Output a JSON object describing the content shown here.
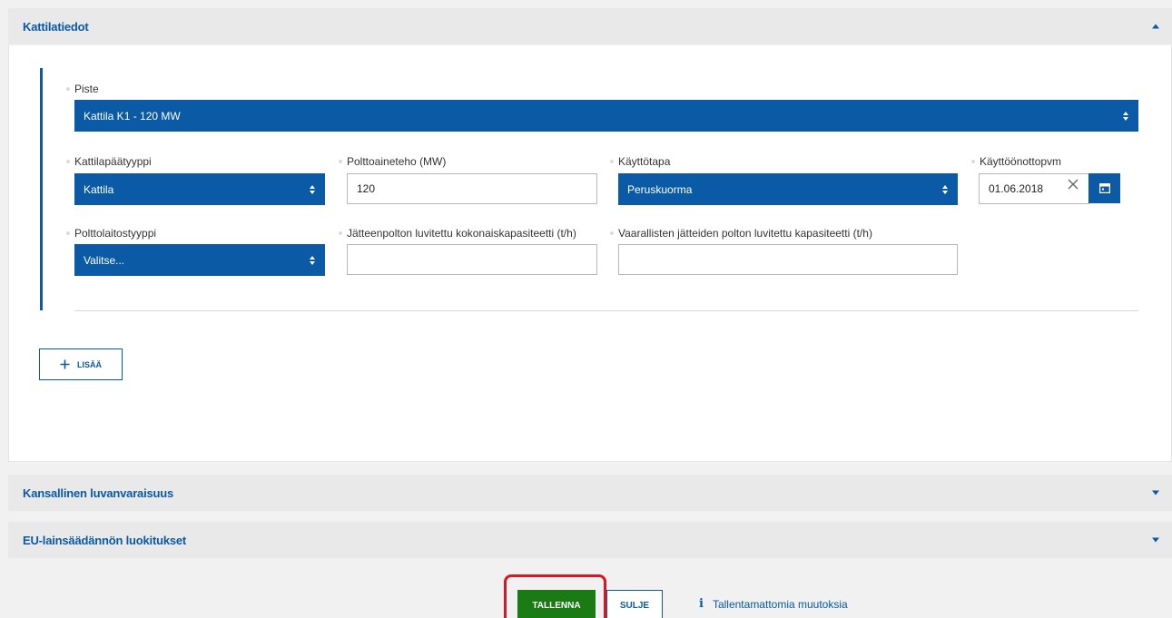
{
  "sections": {
    "kattilatiedot": {
      "title": "Kattilatiedot"
    },
    "kansallinen": {
      "title": "Kansallinen luvanvaraisuus"
    },
    "eu": {
      "title": "EU-lainsäädännön luokitukset"
    }
  },
  "form": {
    "piste": {
      "label": "Piste",
      "value": "Kattila K1 - 120 MW"
    },
    "kattilapaatyyppi": {
      "label": "Kattilapäätyyppi",
      "value": "Kattila"
    },
    "polttoaineteho": {
      "label": "Polttoaineteho (MW)",
      "value": "120"
    },
    "kayttotapa": {
      "label": "Käyttötapa",
      "value": "Peruskuorma"
    },
    "kayttoonottopvm": {
      "label": "Käyttöönottopvm",
      "value": "01.06.2018"
    },
    "polttolaitostyyppi": {
      "label": "Polttolaitostyyppi",
      "value": "Valitse..."
    },
    "jatteenpolton": {
      "label": "Jätteenpolton luvitettu kokonaiskapasiteetti (t/h)",
      "value": ""
    },
    "vaarallisten": {
      "label": "Vaarallisten jätteiden polton luvitettu kapasiteetti (t/h)",
      "value": ""
    }
  },
  "add_button": {
    "label": "LISÄÄ"
  },
  "footer": {
    "save_label": "TALLENNA",
    "close_label": "SULJE",
    "info_text": "Tallentamattomia muutoksia",
    "info_icon": "i"
  },
  "colors": {
    "primary": "#0a5aa6",
    "save": "#1a7a14",
    "highlight": "#e0141e"
  }
}
